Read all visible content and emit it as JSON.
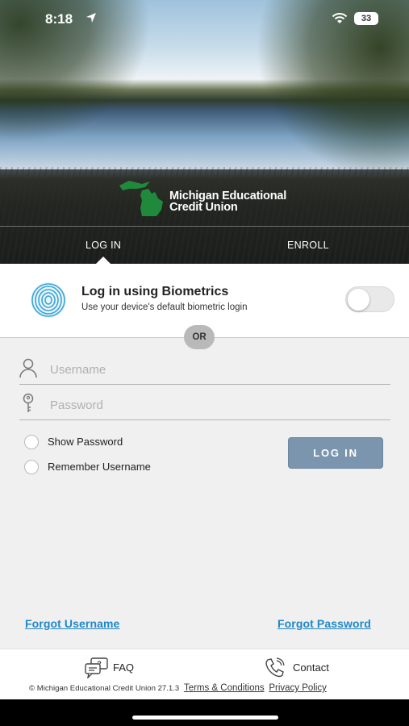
{
  "status_bar": {
    "time": "8:18",
    "battery": "33"
  },
  "brand": {
    "name_line1": "Michigan Educational",
    "name_line2": "Credit Union"
  },
  "tabs": [
    {
      "label": "LOG IN",
      "active": true
    },
    {
      "label": "ENROLL",
      "active": false
    }
  ],
  "biometrics": {
    "title": "Log in using Biometrics",
    "subtitle": "Use your device's default biometric login",
    "enabled": false
  },
  "divider_text": "OR",
  "form": {
    "username_placeholder": "Username",
    "password_placeholder": "Password",
    "show_password_label": "Show Password",
    "remember_username_label": "Remember Username",
    "login_button": "LOG IN"
  },
  "links": {
    "forgot_username": "Forgot Username",
    "forgot_password": "Forgot Password"
  },
  "footer": {
    "faq": "FAQ",
    "contact": "Contact",
    "copyright": "© Michigan Educational Credit Union 27.1.3",
    "terms": "Terms & Conditions",
    "privacy": "Privacy Policy"
  },
  "colors": {
    "accent_link": "#1f87c9",
    "login_button": "#7b95ae",
    "logo_green": "#1f8a3c",
    "fingerprint": "#3aa4d6"
  }
}
